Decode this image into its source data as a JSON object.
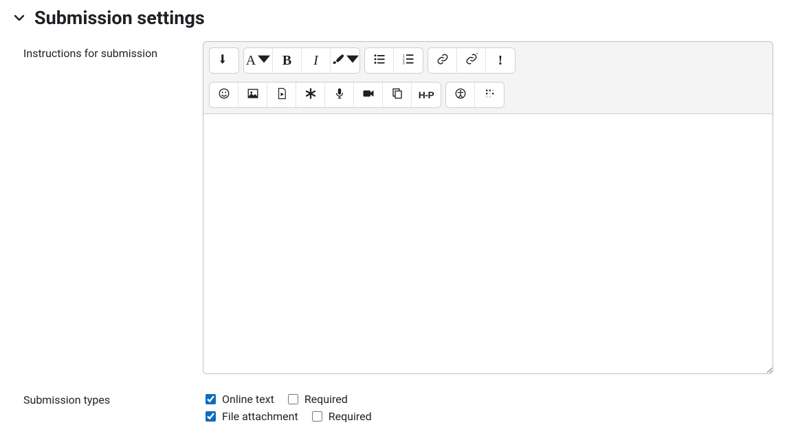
{
  "section": {
    "title": "Submission settings"
  },
  "instructions": {
    "label": "Instructions for submission",
    "content": ""
  },
  "toolbar": {
    "row1": {
      "toggle": "toggle-toolbar",
      "font_letter": "A",
      "bold_letter": "B",
      "italic_letter": "I"
    }
  },
  "submissionTypes": {
    "label": "Submission types",
    "onlineText": {
      "label": "Online text",
      "checked": true,
      "requiredLabel": "Required",
      "requiredChecked": false
    },
    "fileAttachment": {
      "label": "File attachment",
      "checked": true,
      "requiredLabel": "Required",
      "requiredChecked": false
    }
  }
}
